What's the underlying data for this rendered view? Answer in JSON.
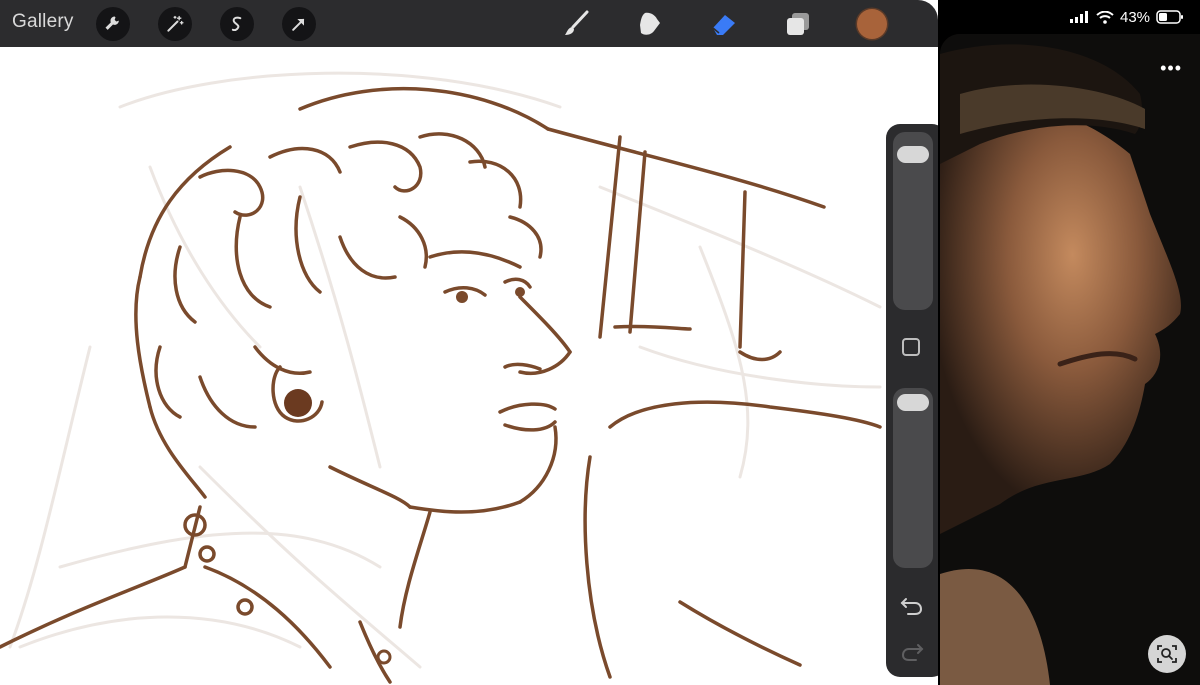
{
  "toolbar": {
    "gallery_label": "Gallery",
    "left_tools": [
      "wrench-icon",
      "magic-wand-icon",
      "selection-icon",
      "transform-arrow-icon"
    ],
    "right_tools": [
      "brush-icon",
      "smudge-icon",
      "eraser-icon",
      "layers-icon"
    ],
    "active_tool": "eraser-icon",
    "current_color": "#a8633a",
    "accent": "#3a7bf6"
  },
  "side_panel": {
    "brush_size_level": 0.07,
    "opacity_level": 0.02
  },
  "status_bar": {
    "battery_percent": "43%"
  },
  "reference_photo": {
    "more_label": "•••"
  }
}
